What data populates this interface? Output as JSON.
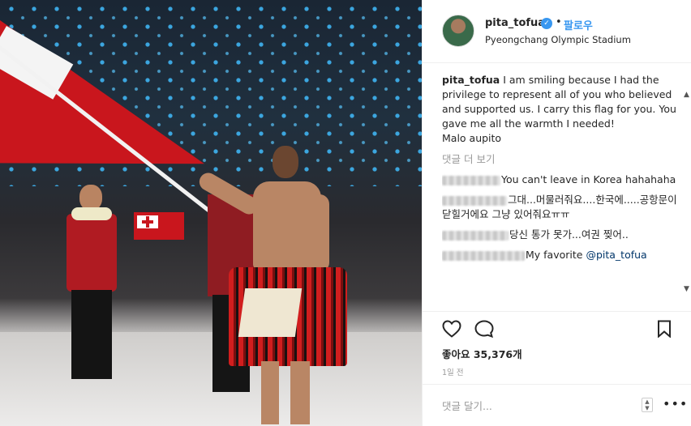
{
  "post": {
    "username": "pita_tofua",
    "follow_label": "팔로우",
    "separator": "•",
    "location": "Pyeongchang Olympic Stadium"
  },
  "caption": {
    "username": "pita_tofua",
    "text": "I am smiling because I had the privilege to represent all of you who believed and supported us. I carry this flag for you. You gave me all the warmth I needed!",
    "signoff": "Malo aupito"
  },
  "more_comments_label": "댓글 더 보기",
  "comments": [
    {
      "text": "You can't leave in Korea hahahaha"
    },
    {
      "text": "그대...머물러줘요....한국에.....공항문이 닫힐거에요 그냥 있어줘요ㅠㅠ"
    },
    {
      "text": "당신 통가 못가...여권 찢어.."
    },
    {
      "text_before": "My favorite ",
      "mention": "@pita_tofua"
    }
  ],
  "likes": "좋아요 35,376개",
  "timestamp": "1일 전",
  "add_comment_placeholder": "댓글 달기...",
  "colors": {
    "accent": "#3897f0",
    "flag_red": "#c9161d",
    "text": "#262626",
    "muted": "#999999"
  },
  "icons": [
    "verified-badge-icon",
    "heart-icon",
    "comment-icon",
    "bookmark-icon",
    "more-options-icon",
    "scroll-up-icon",
    "scroll-down-icon"
  ]
}
